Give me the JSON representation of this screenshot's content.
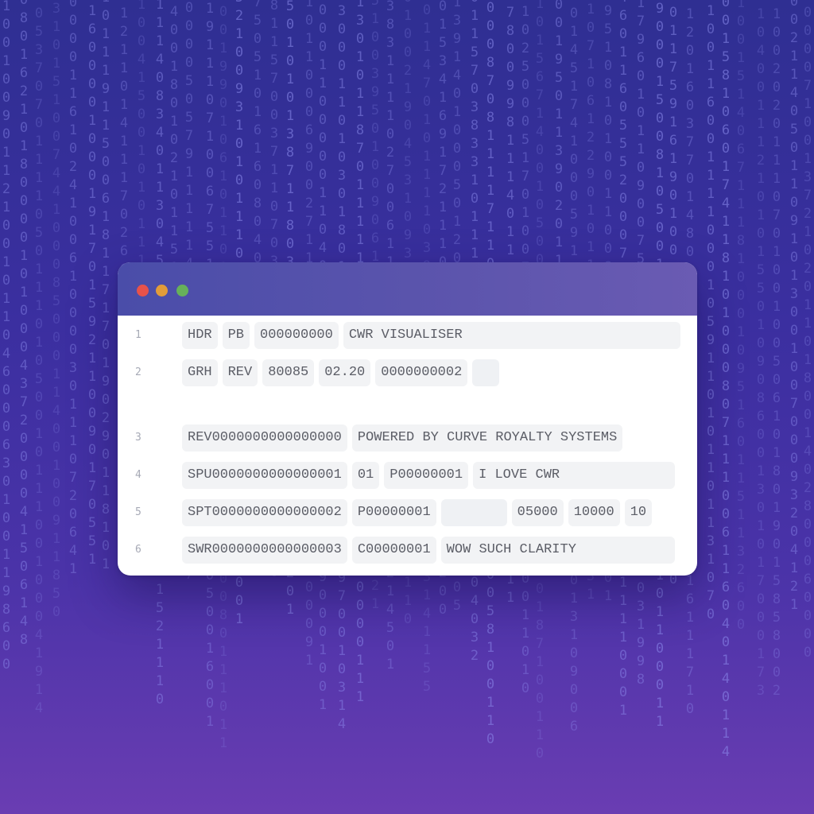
{
  "window": {
    "controls": [
      {
        "name": "close",
        "color": "#e8524a"
      },
      {
        "name": "minimize",
        "color": "#e29c3a"
      },
      {
        "name": "maximize",
        "color": "#67b05a"
      }
    ]
  },
  "lines": [
    {
      "number": "1",
      "fields": [
        "HDR",
        "PB",
        "000000000",
        "CWR VISUALISER"
      ]
    },
    {
      "number": "2",
      "fields": [
        "GRH",
        "REV",
        "80085",
        "02.20",
        "0000000002",
        ""
      ]
    },
    {
      "number": "3",
      "fields": [
        "REV0000000000000000",
        "POWERED BY CURVE ROYALTY SYSTEMS"
      ]
    },
    {
      "number": "4",
      "fields": [
        "SPU0000000000000001",
        "01",
        "P00000001",
        "I LOVE CWR"
      ]
    },
    {
      "number": "5",
      "fields": [
        "SPT0000000000000002",
        "P00000001",
        "",
        "05000",
        "10000",
        "10"
      ]
    },
    {
      "number": "6",
      "fields": [
        "SWR0000000000000003",
        "C00000001",
        "WOW SUCH CLARITY"
      ]
    }
  ]
}
